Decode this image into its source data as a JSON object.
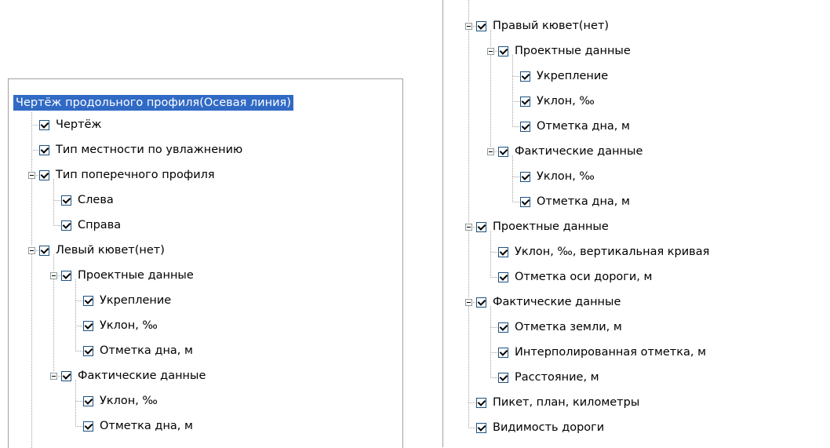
{
  "left_panel": {
    "root": "Чертёж продольного профиля(Осевая линия)",
    "items": [
      {
        "level": 1,
        "label": "Чертёж"
      },
      {
        "level": 1,
        "label": "Тип местности по увлажнению"
      },
      {
        "level": 1,
        "label": "Тип поперечного профиля",
        "expanded": true
      },
      {
        "level": 2,
        "label": "Слева"
      },
      {
        "level": 2,
        "label": "Справа"
      },
      {
        "level": 1,
        "label": "Левый кювет(нет)",
        "expanded": true
      },
      {
        "level": 2,
        "label": "Проектные данные",
        "expanded": true
      },
      {
        "level": 3,
        "label": "Укрепление"
      },
      {
        "level": 3,
        "label": "Уклон, ‰"
      },
      {
        "level": 3,
        "label": "Отметка дна, м"
      },
      {
        "level": 2,
        "label": "Фактические данные",
        "expanded": true
      },
      {
        "level": 3,
        "label": "Уклон, ‰"
      },
      {
        "level": 3,
        "label": "Отметка дна, м"
      }
    ]
  },
  "right_panel": {
    "items": [
      {
        "level": 1,
        "label": "Правый кювет(нет)",
        "expanded": true
      },
      {
        "level": 2,
        "label": "Проектные данные",
        "expanded": true
      },
      {
        "level": 3,
        "label": "Укрепление"
      },
      {
        "level": 3,
        "label": "Уклон, ‰"
      },
      {
        "level": 3,
        "label": "Отметка дна, м"
      },
      {
        "level": 2,
        "label": "Фактические данные",
        "expanded": true
      },
      {
        "level": 3,
        "label": "Уклон, ‰"
      },
      {
        "level": 3,
        "label": "Отметка дна, м"
      },
      {
        "level": 1,
        "label": "Проектные данные",
        "expanded": true
      },
      {
        "level": 2,
        "label": "Уклон, ‰, вертикальная кривая"
      },
      {
        "level": 2,
        "label": "Отметка оси дороги, м"
      },
      {
        "level": 1,
        "label": "Фактические данные",
        "expanded": true
      },
      {
        "level": 2,
        "label": "Отметка земли, м"
      },
      {
        "level": 2,
        "label": "Интерполированная отметка, м"
      },
      {
        "level": 2,
        "label": "Расстояние, м"
      },
      {
        "level": 1,
        "label": "Пикет, план, километры"
      },
      {
        "level": 1,
        "label": "Видимость дороги"
      }
    ]
  },
  "colors": {
    "selection": "#316ac5",
    "tree_line": "#a0a0a0",
    "checkbox_border": "#1c5180"
  }
}
